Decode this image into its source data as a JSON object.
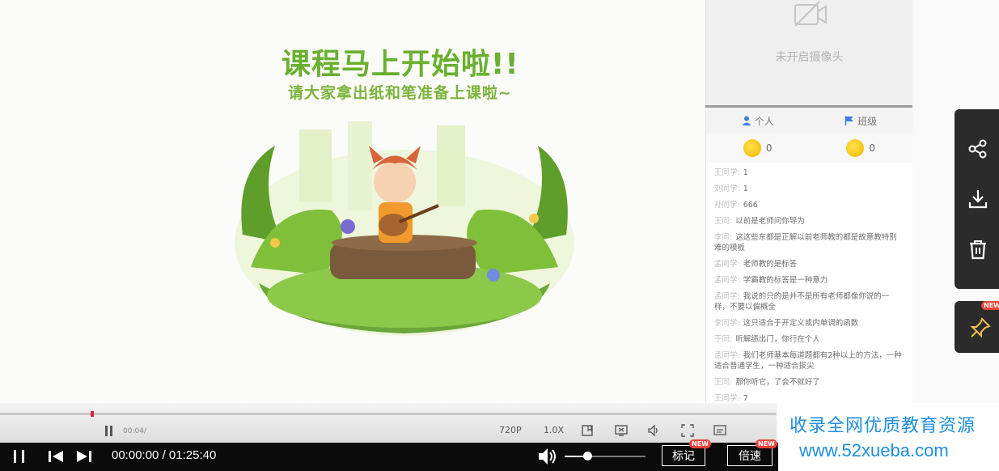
{
  "slide": {
    "title": "课程马上开始啦!!",
    "subtitle": "请大家拿出纸和笔准备上课啦~"
  },
  "camera": {
    "status": "未开启摄像头",
    "icon": "camera-off-icon"
  },
  "sidebar": {
    "tabs": [
      {
        "label": "个人",
        "icon": "person-icon"
      },
      {
        "label": "班级",
        "icon": "flag-icon"
      }
    ],
    "coins": [
      {
        "count": "0",
        "icon": "coin-icon"
      },
      {
        "count": "0",
        "icon": "coin-icon"
      }
    ],
    "messages": [
      {
        "name": "王同学:",
        "text": "1"
      },
      {
        "name": "刘同学:",
        "text": "1"
      },
      {
        "name": "孙同学:",
        "text": "666"
      },
      {
        "name": "王同:",
        "text": "以前是老师问你导为"
      },
      {
        "name": "李同:",
        "text": "这这些东都是正解以前老师教的都是故意教特别难的模板"
      },
      {
        "name": "孟同学:",
        "text": "老师教的是标答"
      },
      {
        "name": "孟同学:",
        "text": "学霸教的标答是一种意力"
      },
      {
        "name": "孟同学:",
        "text": "我说的只的是并不是所有老师都像你说的一样，不要以偏概全"
      },
      {
        "name": "李同学:",
        "text": "这只适合于开定义或内单调的函数"
      },
      {
        "name": "于同:",
        "text": "听解绩出门，你行在个人"
      },
      {
        "name": "孟同学:",
        "text": "我们老师基本每道题都有2种以上的方法，一种适合普通学生，一种适合拔尖"
      },
      {
        "name": "王同:",
        "text": "那你听它，了会不就好了"
      },
      {
        "name": "王同学:",
        "text": "7"
      }
    ]
  },
  "float_toolbar": {
    "share_icon": "share-icon",
    "download_icon": "download-icon",
    "delete_icon": "trash-icon",
    "pin_icon": "pin-icon",
    "new_badge": "NEW"
  },
  "inner_controls": {
    "time": "00:04/",
    "quality": "720P",
    "speed": "1.0X"
  },
  "player": {
    "current_time": "00:00:00",
    "separator": "/",
    "duration": "01:25:40",
    "volume_percent": 28,
    "mark_label": "标记",
    "speed_label": "倍速",
    "new_badge": "NEW"
  },
  "watermark": {
    "line1": "收录全网优质教育资源",
    "line2": "www.52xueba.com"
  },
  "colors": {
    "title_green": "#6ab02f",
    "watermark_blue": "#1f8fe0",
    "badge_red": "#e8433b"
  }
}
